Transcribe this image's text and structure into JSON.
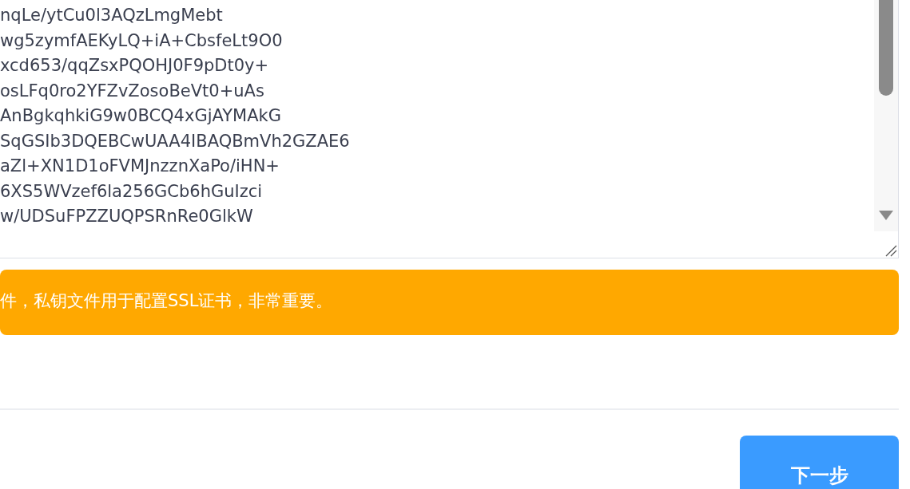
{
  "key_field": {
    "lines": [
      "nqLe/ytCu0l3AQzLmgMebt",
      "wg5zymfAEKyLQ+iA+CbsfeLt9O0",
      "xcd653/qqZsxPQOHJ0F9pDt0y+",
      "osLFq0ro2YFZvZosoBeVt0+uAs",
      "AnBgkqhkiG9w0BCQ4xGjAYMAkG",
      "SqGSIb3DQEBCwUAA4IBAQBmVh2GZAE6",
      "aZl+XN1D1oFVMJnzznXaPo/iHN+",
      "6XS5WVzef6la256GCb6hGuIzci",
      "w/UDSuFPZZUQPSRnRe0GlkW"
    ]
  },
  "alert": {
    "kind": "warning",
    "text": "件，私钥文件用于配置SSL证书，非常重要。"
  },
  "next_button": {
    "label": "下一步"
  }
}
